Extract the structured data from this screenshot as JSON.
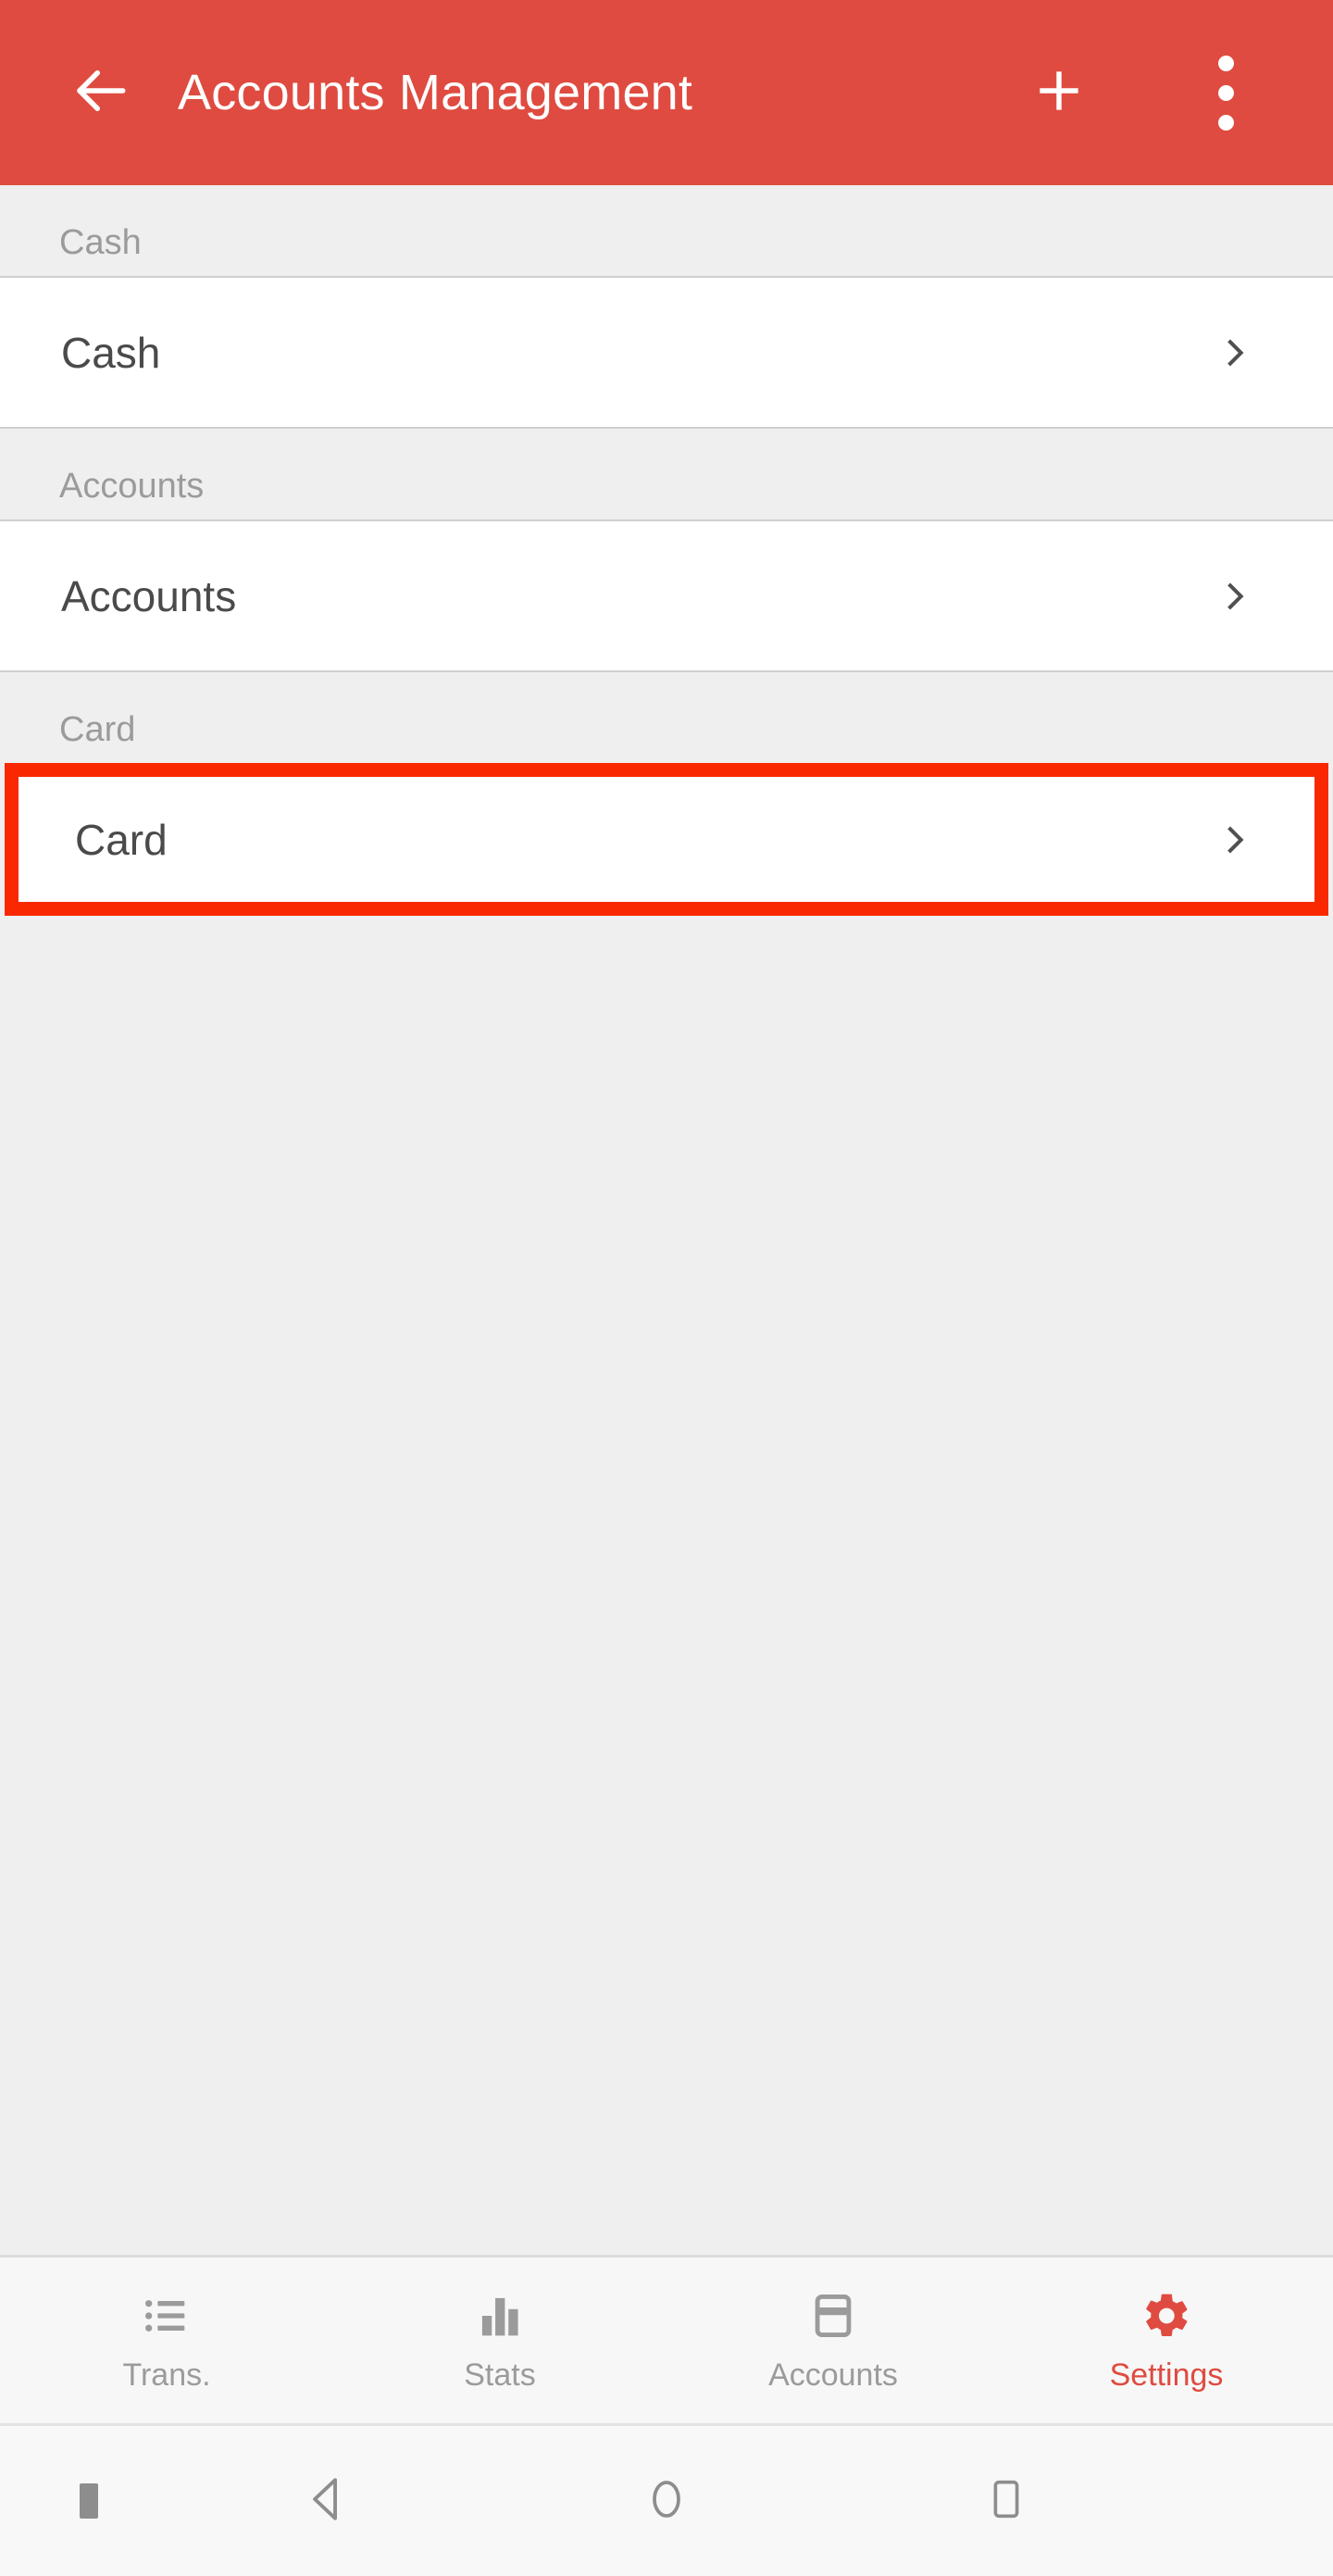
{
  "appbar": {
    "title": "Accounts Management",
    "back_icon": "arrow-left-icon",
    "add_icon": "plus-icon",
    "more_icon": "overflow-menu-icon",
    "background_color": "#df4b40",
    "text_color": "#ffffff"
  },
  "highlight": {
    "color": "#fa2800",
    "target": "card-row"
  },
  "sections": [
    {
      "header": "Cash",
      "row_label": "Cash",
      "chevron_icon": "chevron-right-icon",
      "highlighted": false
    },
    {
      "header": "Accounts",
      "row_label": "Accounts",
      "chevron_icon": "chevron-right-icon",
      "highlighted": false
    },
    {
      "header": "Card",
      "row_label": "Card",
      "chevron_icon": "chevron-right-icon",
      "highlighted": true
    }
  ],
  "bottom_nav": {
    "active_color": "#df4b40",
    "inactive_color": "#9b9b9b",
    "items": [
      {
        "label": "Trans.",
        "icon": "list-icon",
        "active": false
      },
      {
        "label": "Stats",
        "icon": "bar-chart-icon",
        "active": false
      },
      {
        "label": "Accounts",
        "icon": "credit-card-icon",
        "active": false
      },
      {
        "label": "Settings",
        "icon": "gear-icon",
        "active": true
      }
    ]
  },
  "system_nav": {
    "marker_icon": "status-marker-icon",
    "back_icon": "triangle-back-icon",
    "home_icon": "circle-home-icon",
    "recents_icon": "square-recents-icon"
  }
}
